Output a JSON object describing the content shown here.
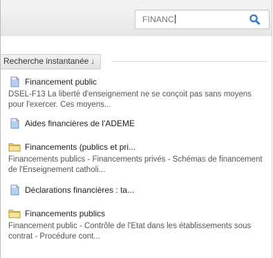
{
  "search": {
    "value": "FINANC",
    "button_icon": "magnifier-icon"
  },
  "section": {
    "label": "Recherche instantanée",
    "sort_icon": "↓"
  },
  "results": [
    {
      "type": "document",
      "icon": "document-icon",
      "title": "Financement public",
      "description": "DSEL-F13 La liberté d'enseignement ne se conçoit pas sans moyens pour l'exercer. Ces moyens..."
    },
    {
      "type": "document",
      "icon": "document-icon",
      "title": "Aides financières de l'ADEME",
      "description": ""
    },
    {
      "type": "folder",
      "icon": "folder-icon",
      "title": "Financements (publics et pri...",
      "description": "Financements publics - Financements privés - Schémas de financement de l'Enseignement catholi..."
    },
    {
      "type": "document",
      "icon": "document-icon",
      "title": "Déclarations financières : ta...",
      "description": ""
    },
    {
      "type": "folder",
      "icon": "folder-icon",
      "title": "Financements publics",
      "description": "Financement public - Contrôle de l'Etat dans les établissements sous contrat - Procédure cont..."
    }
  ],
  "colors": {
    "accent_blue": "#2f7fd4",
    "folder_yellow": "#f0d46a",
    "document_blue": "#8fb3e0"
  }
}
